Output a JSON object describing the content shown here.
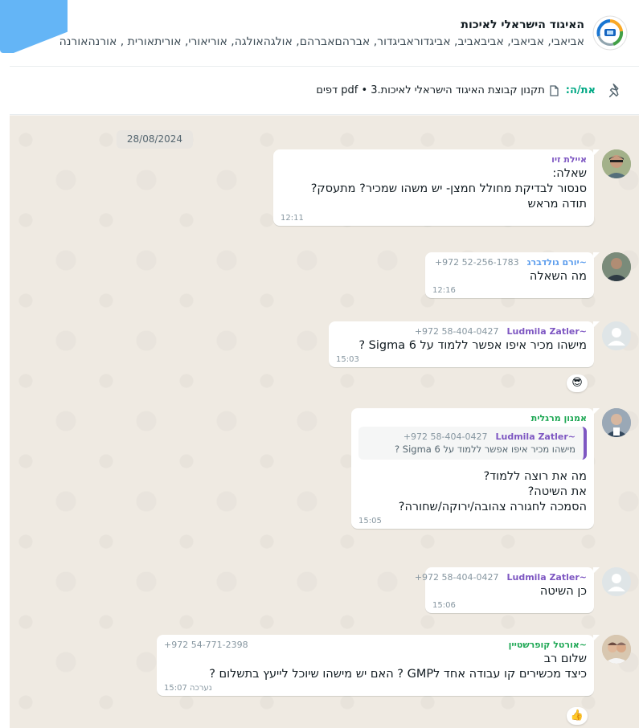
{
  "header": {
    "title": "האיגוד הישראלי לאיכות",
    "participants": "אביאבי, אביאבי, אביבאביב, אביגדוראביגדור, אברהםאברהם, אולגהאולגה, אוריאורי,  אוריתאורית , אורנהאורנה"
  },
  "pinned": {
    "label": "את/ה:",
    "file": "תקנון קבוצת האיגוד הישראלי לאיכות.3 • pdf דפים"
  },
  "chat": {
    "date": "28/08/2024",
    "messages": [
      {
        "sender": "איילת זיו",
        "phone": "",
        "text": "שאלה:\nסנסור לבדיקת מחולל חמצן- יש משהו שמכיר? מתעסק?\nתודה מראש",
        "time": "12:11",
        "color": "#7e57c2"
      },
      {
        "sender": "~יורם גולדברג",
        "phone": "+972 52-256-1783",
        "text": "מה השאלה",
        "time": "12:16",
        "color": "#5c9ded"
      },
      {
        "sender": "~Ludmila Zatler",
        "phone": "+972 58-404-0427",
        "text": "מישהו מכיר איפו אפשר ללמוד על Sigma 6 ?",
        "time": "15:03",
        "color": "#7e57c2",
        "reaction": "😎"
      },
      {
        "sender": "אמנון מרגלית",
        "phone": "",
        "text": "מה את רוצה ללמוד?\nאת השיטה?\nהסמכה לחגורה צהובה/ירוקה/שחורה?",
        "time": "15:05",
        "color": "#1fa855",
        "quote": {
          "sender": "~Ludmila Zatler",
          "phone": "+972 58-404-0427",
          "text": "מישהו מכיר איפו אפשר ללמוד על Sigma 6 ?"
        }
      },
      {
        "sender": "~Ludmila Zatler",
        "phone": "+972 58-404-0427",
        "text": "כן השיטה",
        "time": "15:06",
        "color": "#7e57c2"
      },
      {
        "sender": "~אורטל קופרשטיין",
        "phone": "+972 54-771-2398",
        "text": "שלום רב\nכיצד מכשירים קו עבודה אחד לGMP ?  האם יש מישהו שיוכל לייעץ בתשלום ?",
        "time": "15:07",
        "edited": "נערכה",
        "color": "#1fa855",
        "reaction": "👍"
      }
    ]
  }
}
